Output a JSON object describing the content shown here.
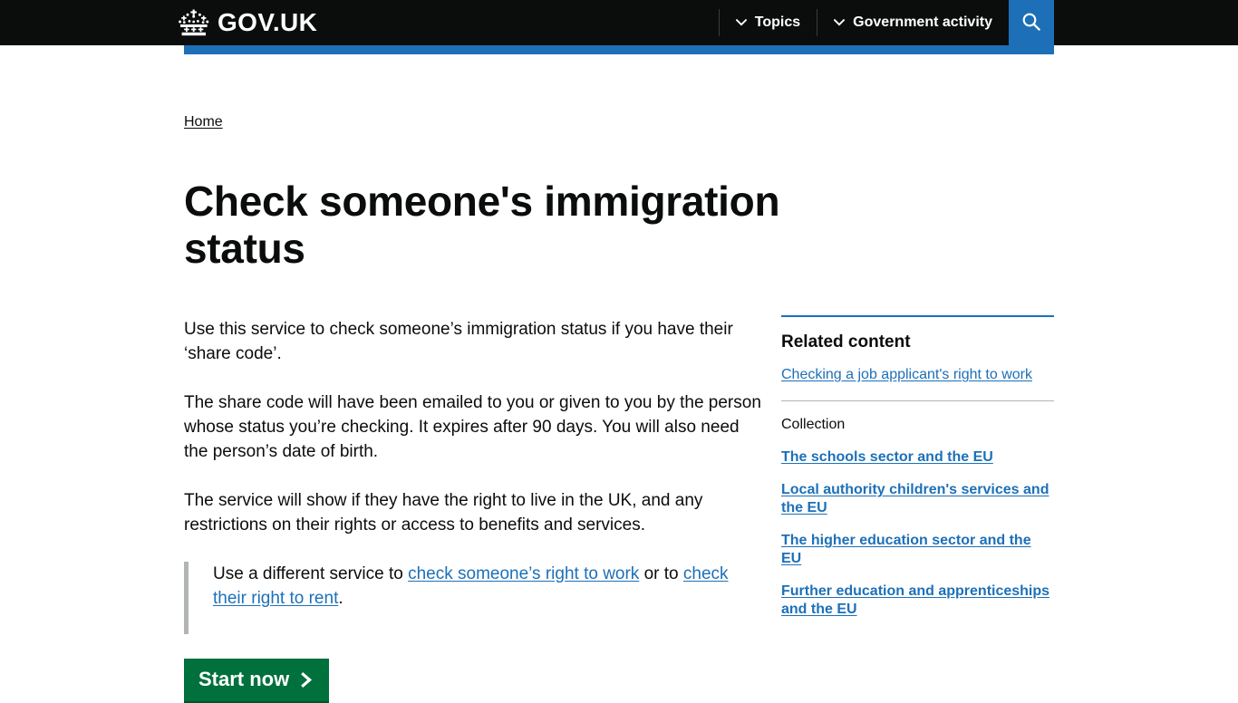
{
  "header": {
    "logo_text": "GOV.UK",
    "crown_icon": "crown-icon",
    "nav": [
      {
        "label": "Topics",
        "icon": "chevron-down-icon"
      },
      {
        "label": "Government activity",
        "icon": "chevron-down-icon"
      }
    ],
    "search_icon": "search-icon"
  },
  "breadcrumb": {
    "items": [
      {
        "label": "Home"
      }
    ]
  },
  "main": {
    "title": "Check someone's immigration status",
    "paragraphs": [
      "Use this service to check someone’s immigration status if you have their ‘share code’.",
      "The share code will have been emailed to you or given to you by the person whose status you’re checking. It expires after 90 days. You will also need the person’s date of birth.",
      "The service will show if they have the right to live in the UK, and any restrictions on their rights or access to benefits and services."
    ],
    "inset": {
      "prefix": "Use a different service to ",
      "link1": "check someone’s right to work",
      "middle": " or to ",
      "link2": "check their right to rent",
      "suffix": "."
    },
    "start_button": {
      "label": "Start now",
      "icon": "arrow-right-icon",
      "color": "#00703c"
    }
  },
  "sidebar": {
    "heading": "Related content",
    "related_links": [
      "Checking a job applicant's right to work"
    ],
    "collection_label": "Collection",
    "collection_links": [
      "The schools sector and the EU",
      "Local authority children's services and the EU",
      "The higher education sector and the EU",
      "Further education and apprenticeships and the EU"
    ]
  },
  "colors": {
    "header_black": "#0b0c0c",
    "govuk_blue": "#1d70b8",
    "green": "#00703c",
    "grey_border": "#b1b4b6"
  }
}
